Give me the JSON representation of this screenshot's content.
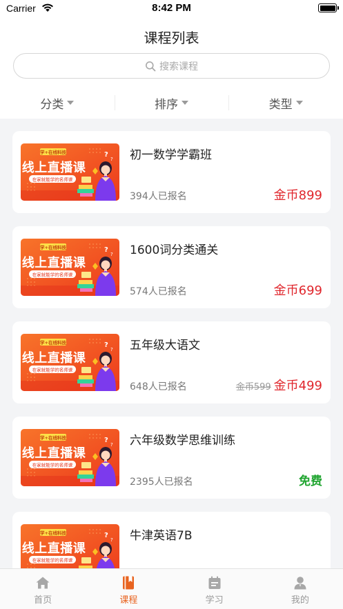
{
  "status_bar": {
    "carrier": "Carrier",
    "time": "8:42 PM"
  },
  "header": {
    "title": "课程列表"
  },
  "search": {
    "placeholder": "搜索课程"
  },
  "filters": [
    {
      "label": "分类"
    },
    {
      "label": "排序"
    },
    {
      "label": "类型"
    }
  ],
  "thumbnail": {
    "badge": "学+在线科技",
    "headline": "线上直播课",
    "tagline": "在家就能学的名师课"
  },
  "courses": [
    {
      "title": "初一数学学霸班",
      "enrolled": "394人已报名",
      "price": "金币899",
      "old_price": ""
    },
    {
      "title": "1600词分类通关",
      "enrolled": "574人已报名",
      "price": "金币699",
      "old_price": ""
    },
    {
      "title": "五年级大语文",
      "enrolled": "648人已报名",
      "price": "金币499",
      "old_price": "金币599"
    },
    {
      "title": "六年级数学思维训练",
      "enrolled": "2395人已报名",
      "price": "免费",
      "old_price": ""
    },
    {
      "title": "牛津英语7B",
      "enrolled": "",
      "price": "",
      "old_price": ""
    }
  ],
  "tabbar": [
    {
      "label": "首页",
      "icon": "home-icon",
      "active": false
    },
    {
      "label": "课程",
      "icon": "book-icon",
      "active": true
    },
    {
      "label": "学习",
      "icon": "calendar-icon",
      "active": false
    },
    {
      "label": "我的",
      "icon": "user-icon",
      "active": false
    }
  ],
  "colors": {
    "accent": "#e8631f",
    "price": "#e0262c",
    "free": "#21a531",
    "inactive": "#999999",
    "banner": "#f25a1f"
  }
}
